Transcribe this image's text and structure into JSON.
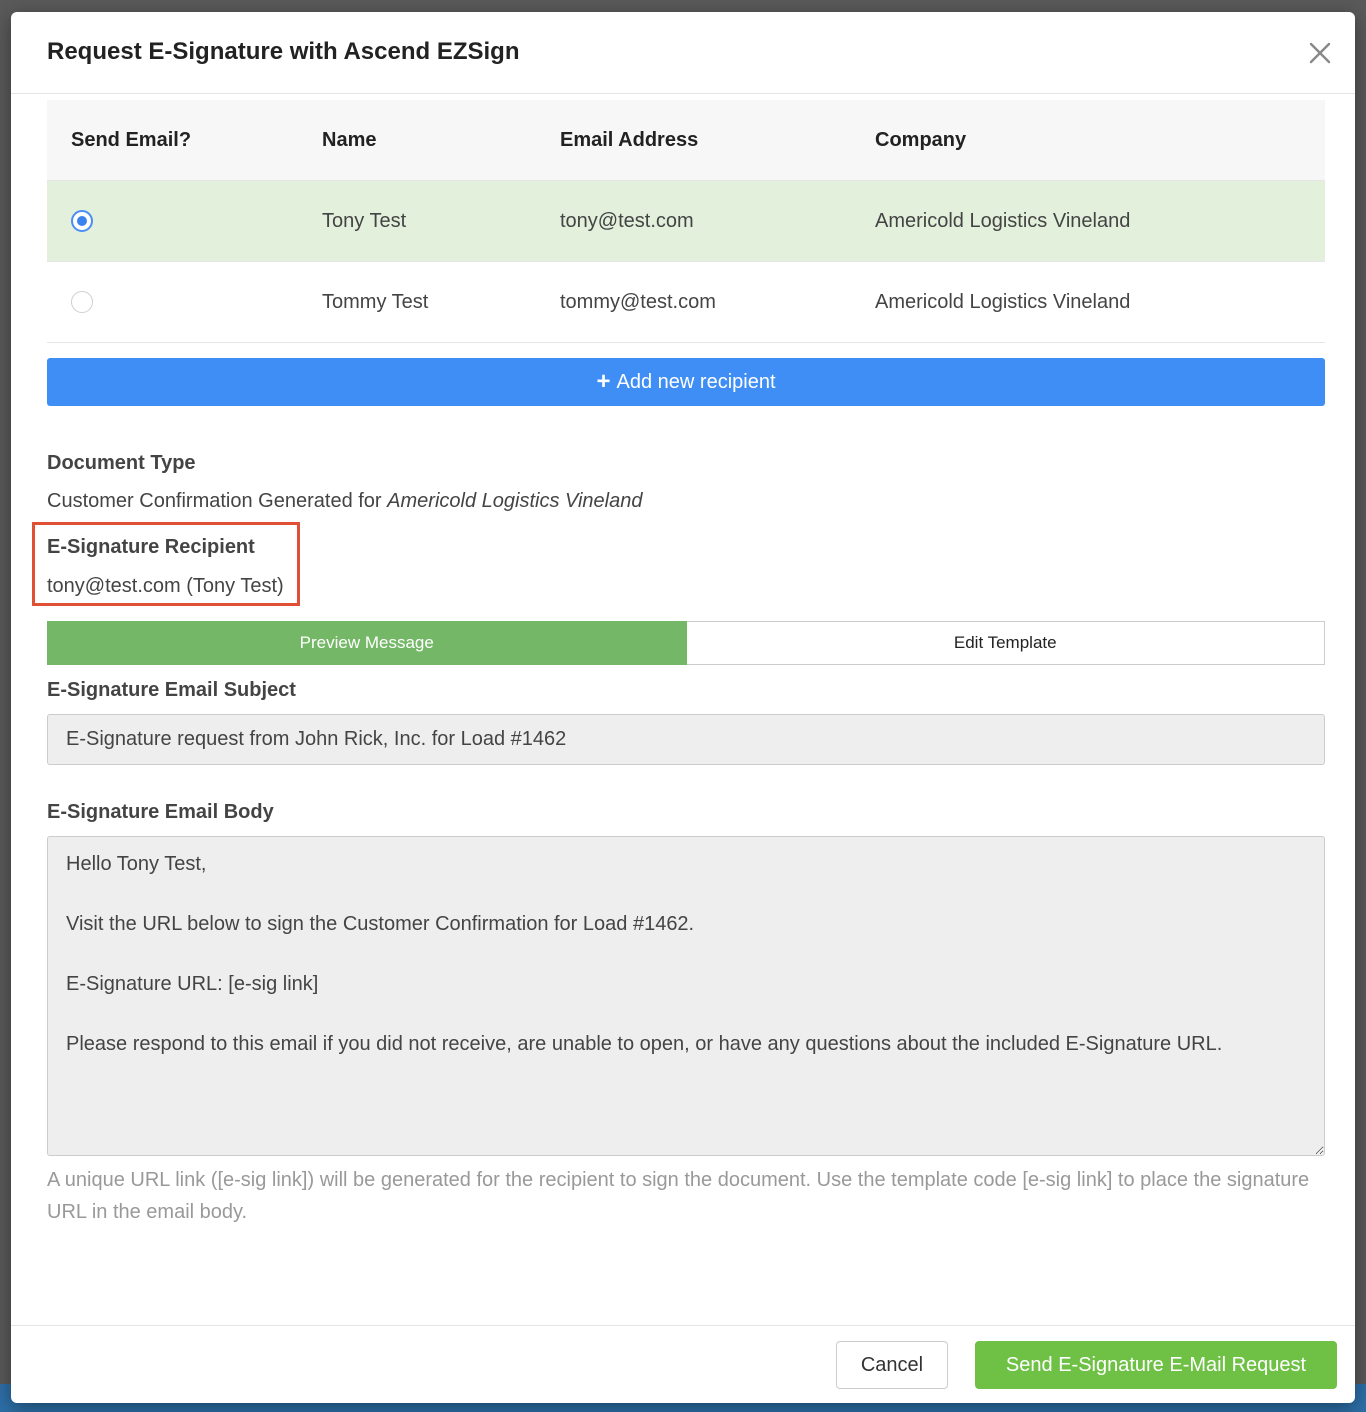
{
  "modal": {
    "title": "Request E-Signature with Ascend EZSign"
  },
  "recipients_table": {
    "headers": {
      "send_email": "Send Email?",
      "name": "Name",
      "email": "Email Address",
      "company": "Company"
    },
    "rows": [
      {
        "selected": true,
        "name": "Tony Test",
        "email": "tony@test.com",
        "company": "Americold Logistics Vineland"
      },
      {
        "selected": false,
        "name": "Tommy Test",
        "email": "tommy@test.com",
        "company": "Americold Logistics Vineland"
      }
    ]
  },
  "add_recipient_label": "Add new recipient",
  "document_type": {
    "label": "Document Type",
    "value_prefix": "Customer Confirmation Generated for ",
    "company": "Americold Logistics Vineland"
  },
  "esig_recipient": {
    "label": "E-Signature Recipient",
    "value": "tony@test.com (Tony Test)"
  },
  "toggle": {
    "preview": "Preview Message",
    "edit": "Edit Template"
  },
  "subject": {
    "label": "E-Signature Email Subject",
    "value": "E-Signature request from John Rick, Inc. for Load #1462"
  },
  "email_body": {
    "label": "E-Signature Email Body",
    "value": "Hello Tony Test,\n\nVisit the URL below to sign the Customer Confirmation for Load #1462.\n\nE-Signature URL: [e-sig link]\n\nPlease respond to this email if you did not receive, are unable to open, or have any questions about the included E-Signature URL."
  },
  "help_text": "A unique URL link ([e-sig link]) will be generated for the recipient to sign the document. Use the template code [e-sig link] to place the signature URL in the email body.",
  "footer": {
    "cancel": "Cancel",
    "send": "Send E-Signature E-Mail Request"
  },
  "colors": {
    "primary_blue": "#3f8ef5",
    "success_green": "#6fc146",
    "toggle_green": "#74b766",
    "selected_row": "#e3f0dc",
    "highlight_red": "#e05034"
  }
}
